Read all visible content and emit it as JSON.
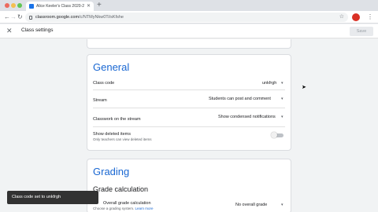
{
  "browser": {
    "tab_title": "Alice Keeler's Class 2020-2",
    "url_host": "classroom.google.com",
    "url_path": "/c/NTMyNkw0Ti/sKfshe"
  },
  "appbar": {
    "title": "Class settings",
    "save_label": "Save"
  },
  "general": {
    "heading": "General",
    "class_code_label": "Class code",
    "class_code_value": "unkfrgh",
    "stream_label": "Stream",
    "stream_value": "Students can post and comment",
    "classwork_label": "Classwork on the stream",
    "classwork_value": "Show condensed notifications",
    "deleted_label": "Show deleted items",
    "deleted_sub": "Only teachers can view deleted items",
    "deleted_toggle_on": false
  },
  "grading": {
    "heading": "Grading",
    "sub_heading": "Grade calculation",
    "overall_label": "Overall grade calculation",
    "overall_sub": "Choose a grading system.",
    "overall_link": "Learn more",
    "overall_value": "No overall grade"
  },
  "snackbar": {
    "text": "Class code set to unkfrgh"
  }
}
